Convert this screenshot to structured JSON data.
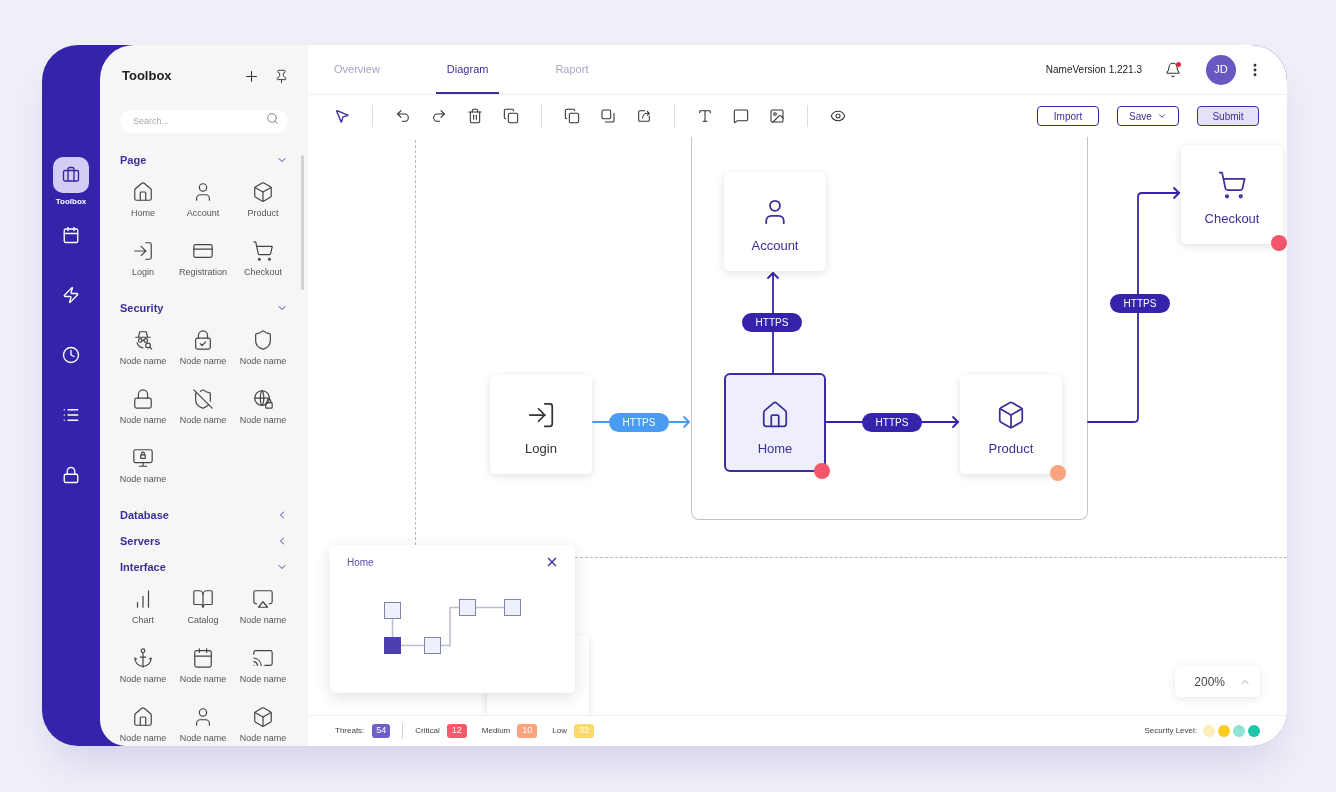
{
  "rail": {
    "items": [
      {
        "label": "Toolbox",
        "selected": true
      },
      {
        "selected": false
      },
      {
        "selected": false
      },
      {
        "selected": false
      },
      {
        "selected": false
      },
      {
        "selected": false
      }
    ]
  },
  "toolbox": {
    "title": "Toolbox",
    "search": {
      "placeholder": "Search..."
    },
    "sections": [
      {
        "title": "Page",
        "expanded": true,
        "items": [
          {
            "label": "Home"
          },
          {
            "label": "Account"
          },
          {
            "label": "Product"
          },
          {
            "label": "Login"
          },
          {
            "label": "Registration"
          },
          {
            "label": "Checkout"
          }
        ]
      },
      {
        "title": "Security",
        "expanded": true,
        "items": [
          {
            "label": "Node name"
          },
          {
            "label": "Node name"
          },
          {
            "label": "Node name"
          },
          {
            "label": "Node name"
          },
          {
            "label": "Node name"
          },
          {
            "label": "Node name"
          },
          {
            "label": "Node name"
          }
        ]
      },
      {
        "title": "Database",
        "expanded": false
      },
      {
        "title": "Servers",
        "expanded": false
      },
      {
        "title": "Interface",
        "expanded": true,
        "items": [
          {
            "label": "Chart"
          },
          {
            "label": "Catalog"
          },
          {
            "label": "Node name"
          },
          {
            "label": "Node name"
          },
          {
            "label": "Node name"
          },
          {
            "label": "Node name"
          },
          {
            "label": "Node name"
          },
          {
            "label": "Node name"
          },
          {
            "label": "Node name"
          }
        ]
      }
    ]
  },
  "header": {
    "tabs": [
      {
        "label": "Overview",
        "selected": false
      },
      {
        "label": "Diagram",
        "selected": true
      },
      {
        "label": "Raport",
        "selected": false
      }
    ],
    "version": "NameVersion 1.221.3",
    "notification": true,
    "avatar": "JD"
  },
  "toolbar": {
    "groups": [
      [
        {
          "selected": true
        }
      ],
      [
        {
          "selected": false
        },
        {
          "selected": false
        },
        {
          "selected": false
        },
        {
          "selected": false
        }
      ],
      [
        {
          "selected": false
        },
        {
          "selected": false
        },
        {
          "selected": false
        }
      ],
      [
        {
          "selected": false
        },
        {
          "selected": false
        },
        {
          "selected": false
        }
      ],
      [
        {
          "selected": false
        }
      ]
    ],
    "actions": [
      {
        "label": "Import",
        "kind": "outline"
      },
      {
        "label": "Save",
        "kind": "dropdown"
      },
      {
        "label": "Submit",
        "kind": "primary"
      }
    ]
  },
  "canvas": {
    "nodes": [
      {
        "label": "Checkout",
        "selected": false,
        "active": true,
        "color": "#f2566b"
      },
      {
        "label": "Account",
        "selected": false,
        "active": true
      },
      {
        "label": "Login",
        "selected": false,
        "active": false
      },
      {
        "label": "Home",
        "selected": true,
        "active": true,
        "color": "#f2566b"
      },
      {
        "label": "Product",
        "selected": false,
        "active": true,
        "color": "#f9a37f"
      }
    ],
    "connections": [
      {
        "label": "HTTPS",
        "color": "#3524a9"
      },
      {
        "label": "HTTPS",
        "color": "#3524a9"
      },
      {
        "label": "HTTPS",
        "color": "#4a9cf3"
      },
      {
        "label": "HTTPS",
        "color": "#3524a9"
      }
    ],
    "minimap": {
      "title": "Home",
      "nodes": [
        {
          "selected": false
        },
        {
          "selected": true
        },
        {
          "selected": false
        },
        {
          "selected": false
        },
        {
          "selected": false
        }
      ]
    },
    "zoom": {
      "value": "200%"
    }
  },
  "status_bar": {
    "threats": {
      "label": "Threats:",
      "count": "54",
      "color": "#6c60c8"
    },
    "severities": [
      {
        "label": "Critical",
        "count": "12",
        "color": "#f35b6c"
      },
      {
        "label": "Medium",
        "count": "10",
        "color": "#fba27f"
      },
      {
        "label": "Low",
        "count": "32",
        "color": "#fcd96b"
      }
    ],
    "security_level": {
      "label": "Security Level:",
      "dots": [
        {
          "color": "#fbf0b9"
        },
        {
          "color": "#fccb1f"
        },
        {
          "color": "#8fe4d6"
        },
        {
          "color": "#1cc8aa"
        }
      ]
    }
  }
}
